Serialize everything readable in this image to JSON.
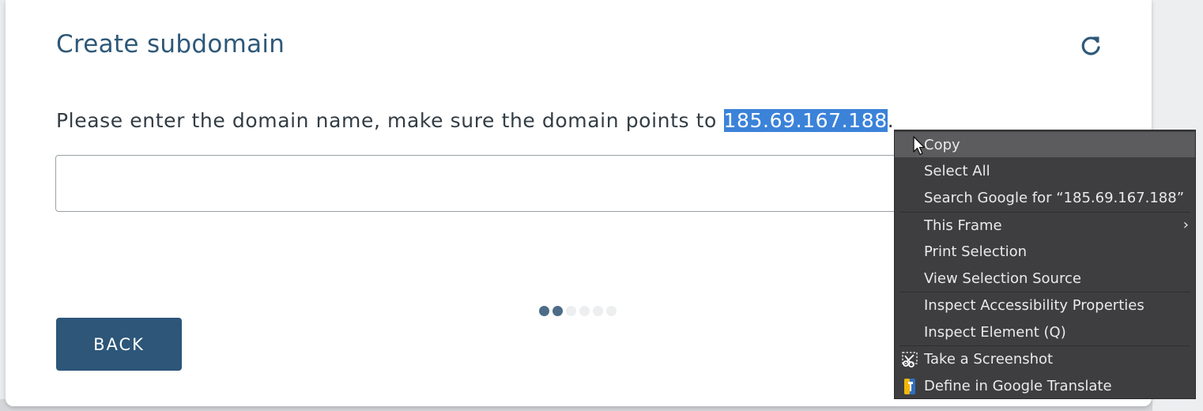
{
  "dialog": {
    "title": "Create subdomain",
    "prompt_prefix": "Please enter the domain name, make sure the domain points to ",
    "ip": "185.69.167.188",
    "prompt_suffix": ".",
    "input": {
      "value": "",
      "placeholder": ""
    },
    "back_label": "BACK",
    "steps": {
      "total": 6,
      "completed": 2
    }
  },
  "context_menu": {
    "items": [
      {
        "label": "Copy",
        "icon": "",
        "highlighted": true
      },
      {
        "label": "Select All",
        "icon": ""
      },
      {
        "label": "Search Google for “185.69.167.188”",
        "icon": ""
      },
      {
        "label": "This Frame",
        "icon": "",
        "submenu": true
      },
      {
        "label": "Print Selection",
        "icon": ""
      },
      {
        "label": "View Selection Source",
        "icon": ""
      },
      {
        "label": "Inspect Accessibility Properties",
        "icon": ""
      },
      {
        "label": "Inspect Element (Q)",
        "icon": ""
      },
      {
        "label": "Take a Screenshot",
        "icon": "screenshot-scissors-icon"
      },
      {
        "label": "Define in Google Translate",
        "icon": "google-translate-icon"
      }
    ]
  },
  "colors": {
    "accent": "#2d5679",
    "title": "#2e5878",
    "selection": "#3b82d9",
    "menu_bg": "#3e3e40"
  }
}
